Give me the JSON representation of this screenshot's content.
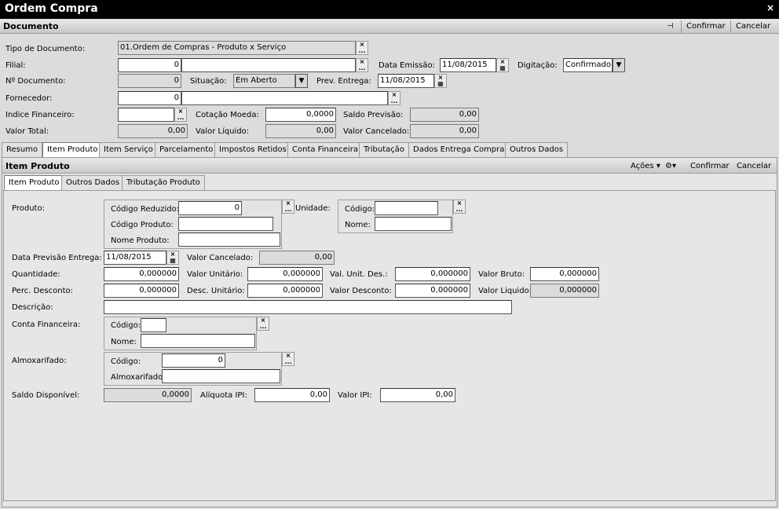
{
  "window": {
    "title": "Ordem Compra",
    "close_glyph": "×"
  },
  "documento": {
    "section_title": "Documento",
    "pin_glyph": "⊣",
    "confirm_label": "Confirmar",
    "cancel_label": "Cancelar",
    "tipo_documento": {
      "label": "Tipo de Documento:",
      "value": "01.Ordem de Compras - Produto x Serviço"
    },
    "filial": {
      "label": "Filial:",
      "code": "0",
      "name": ""
    },
    "data_emissao": {
      "label": "Data Emissão:",
      "value": "11/08/2015"
    },
    "digitacao": {
      "label": "Digitação:",
      "value": "Confirmado"
    },
    "n_documento": {
      "label": "Nº Documento:",
      "value": "0"
    },
    "situacao": {
      "label": "Situação:",
      "value": "Em Aberto"
    },
    "prev_entrega": {
      "label": "Prev. Entrega:",
      "value": "11/08/2015"
    },
    "fornecedor": {
      "label": "Fornecedor:",
      "code": "0",
      "name": ""
    },
    "indice_financeiro": {
      "label": "Indice Financeiro:",
      "value": ""
    },
    "cotacao_moeda": {
      "label": "Cotação Moeda:",
      "value": "0,0000"
    },
    "saldo_previsao": {
      "label": "Saldo Previsão:",
      "value": "0,00"
    },
    "valor_total": {
      "label": "Valor Total:",
      "value": "0,00"
    },
    "valor_liquido": {
      "label": "Valor Líquido:",
      "value": "0,00"
    },
    "valor_cancelado": {
      "label": "Valor Cancelado:",
      "value": "0,00"
    }
  },
  "main_tabs": [
    "Resumo",
    "Item Produto",
    "Item Serviço",
    "Parcelamento",
    "Impostos Retidos",
    "Conta Financeira",
    "Tributação",
    "Dados Entrega Compra",
    "Outros Dados"
  ],
  "item_produto": {
    "section_title": "Item Produto",
    "acoes_label": "Ações",
    "confirm_label": "Confirmar",
    "cancel_label": "Cancelar",
    "sub_tabs": [
      "Item Produto",
      "Outros Dados",
      "Tributação Produto"
    ],
    "produto": {
      "label": "Produto:",
      "codigo_reduzido": {
        "label": "Código Reduzido:",
        "value": "0"
      },
      "codigo_produto": {
        "label": "Código Produto:",
        "value": ""
      },
      "nome_produto": {
        "label": "Nome Produto:",
        "value": ""
      }
    },
    "unidade": {
      "label": "Unidade:",
      "codigo": {
        "label": "Código:",
        "value": ""
      },
      "nome": {
        "label": "Nome:",
        "value": ""
      }
    },
    "data_previsao_entrega": {
      "label": "Data Previsão Entrega:",
      "value": "11/08/2015"
    },
    "valor_cancelado": {
      "label": "Valor Cancelado:",
      "value": "0,00"
    },
    "quantidade": {
      "label": "Quantidade:",
      "value": "0,000000"
    },
    "valor_unitario": {
      "label": "Valor Unitário:",
      "value": "0,000000"
    },
    "val_unit_des": {
      "label": "Val. Unit. Des.:",
      "value": "0,000000"
    },
    "valor_bruto": {
      "label": "Valor Bruto:",
      "value": "0,000000"
    },
    "perc_desconto": {
      "label": "Perc. Desconto:",
      "value": "0,000000"
    },
    "desc_unitario": {
      "label": "Desc. Unitário:",
      "value": "0,000000"
    },
    "valor_desconto": {
      "label": "Valor Desconto:",
      "value": "0,000000"
    },
    "valor_liquido": {
      "label": "Valor Liquido:",
      "value": "0,000000"
    },
    "descricao": {
      "label": "Descrição:",
      "value": ""
    },
    "conta_financeira": {
      "label": "Conta Financeira:",
      "codigo": {
        "label": "Código:",
        "value": ""
      },
      "nome": {
        "label": "Nome:",
        "value": ""
      }
    },
    "almoxarifado": {
      "label": "Almoxarifado:",
      "codigo": {
        "label": "Código:",
        "value": "0"
      },
      "almoxarifado": {
        "label": "Almoxarifado:",
        "value": ""
      }
    },
    "saldo_disponivel": {
      "label": "Saldo Disponível:",
      "value": "0,0000"
    },
    "aliquota_ipi": {
      "label": "Alíquota IPI:",
      "value": "0,00"
    },
    "valor_ipi": {
      "label": "Valor IPI:",
      "value": "0,00"
    }
  },
  "icons": {
    "clear": "×",
    "lookup": "...",
    "calendar": "▦",
    "dropdown": "▼",
    "dropdown_small": "▾"
  }
}
